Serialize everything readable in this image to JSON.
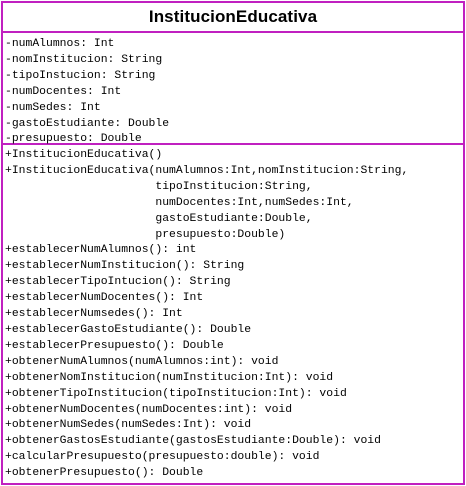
{
  "class_name": "InstitucionEducativa",
  "attributes": [
    "-numAlumnos: Int",
    "-nomInstitucion: String",
    "-tipoInstucion: String",
    "-numDocentes: Int",
    "-numSedes: Int",
    "-gastoEstudiante: Double",
    "-presupuesto: Double"
  ],
  "methods": [
    "+InstitucionEducativa()",
    "+InstitucionEducativa(numAlumnos:Int,nomInstitucion:String,",
    "                      tipoInstitucion:String,",
    "                      numDocentes:Int,numSedes:Int,",
    "                      gastoEstudiante:Double,",
    "                      presupuesto:Double)",
    "+establecerNumAlumnos(): int",
    "+establecerNumInstitucion(): String",
    "+establecerTipoIntucion(): String",
    "+establecerNumDocentes(): Int",
    "+establecerNumsedes(): Int",
    "+establecerGastoEstudiante(): Double",
    "+establecerPresupuesto(): Double",
    "+obtenerNumAlumnos(numAlumnos:int): void",
    "+obtenerNomInstitucion(numInstitucion:Int): void",
    "+obtenerTipoInstitucion(tipoInstitucion:Int): void",
    "+obtenerNumDocentes(numDocentes:int): void",
    "+obtenerNumSedes(numSedes:Int): void",
    "+obtenerGastosEstudiante(gastosEstudiante:Double): void",
    "+calcularPresupuesto(presupuesto:double): void",
    "+obtenerPresupuesto(): Double"
  ]
}
